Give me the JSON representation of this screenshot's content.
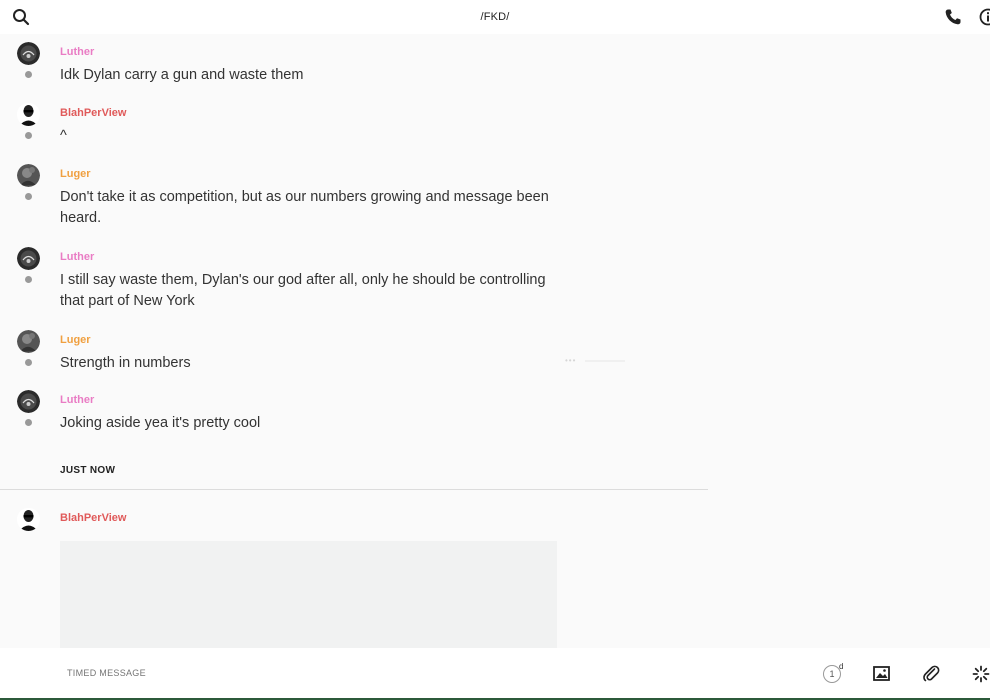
{
  "header": {
    "title": "/FKD/"
  },
  "messages": [
    {
      "author": "Luther",
      "author_color": "#e97cc4",
      "avatar": "dark-round-avatar",
      "text": "Idk Dylan carry a gun and waste them"
    },
    {
      "author": "BlahPerView",
      "author_color": "#e05a5a",
      "avatar": "person-sunglasses-avatar",
      "text": "^"
    },
    {
      "author": "Luger",
      "author_color": "#f0a040",
      "avatar": "grey-portrait-avatar",
      "text": "Don't take it as competition, but as our numbers growing and message  been heard."
    },
    {
      "author": "Luther",
      "author_color": "#e97cc4",
      "avatar": "dark-round-avatar",
      "text": "I still say waste them, Dylan's our god after all, only he should be controlling that part of New York"
    },
    {
      "author": "Luger",
      "author_color": "#f0a040",
      "avatar": "grey-portrait-avatar",
      "text": "Strength in numbers"
    },
    {
      "author": "Luther",
      "author_color": "#e97cc4",
      "avatar": "dark-round-avatar",
      "text": "Joking aside yea it's pretty cool"
    }
  ],
  "divider": {
    "label": "JUST NOW"
  },
  "latest": {
    "author": "BlahPerView",
    "author_color": "#e05a5a"
  },
  "composer": {
    "placeholder": "TIMED MESSAGE",
    "timer_value": "1",
    "timer_unit": "d"
  },
  "icons": {
    "search": "search-icon",
    "phone": "phone-icon",
    "info": "info-icon",
    "image": "image-icon",
    "attach": "paperclip-icon",
    "spinner": "loading-icon"
  }
}
